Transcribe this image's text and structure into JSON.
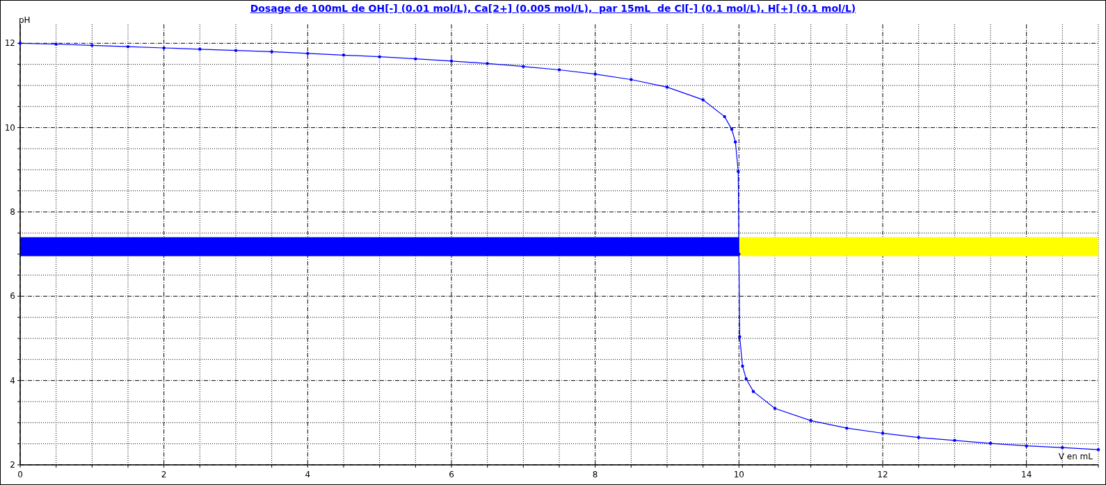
{
  "chart_data": {
    "type": "line",
    "title": "Dosage de 100mL de OH[-] (0.01 mol/L), Ca[2+] (0.005 mol/L),  par 15mL  de Cl[-] (0.1 mol/L), H[+] (0.1 mol/L)",
    "xlabel": "V en mL",
    "ylabel": "pH",
    "x": [
      0,
      0.5,
      1,
      1.5,
      2,
      2.5,
      3,
      3.5,
      4,
      4.5,
      5,
      5.5,
      6,
      6.5,
      7,
      7.5,
      8,
      8.5,
      9,
      9.5,
      9.8,
      9.9,
      9.95,
      9.99,
      10,
      10.01,
      10.05,
      10.1,
      10.2,
      10.5,
      11,
      11.5,
      12,
      12.5,
      13,
      13.5,
      14,
      14.5,
      15
    ],
    "series": [
      {
        "color": "#0000ff",
        "values": [
          12.0,
          11.98,
          11.95,
          11.92,
          11.89,
          11.86,
          11.83,
          11.8,
          11.76,
          11.72,
          11.68,
          11.63,
          11.58,
          11.52,
          11.45,
          11.37,
          11.27,
          11.14,
          10.96,
          10.66,
          10.26,
          9.96,
          9.66,
          8.96,
          7.0,
          5.04,
          4.34,
          4.04,
          3.74,
          3.34,
          3.05,
          2.87,
          2.75,
          2.65,
          2.58,
          2.51,
          2.45,
          2.41,
          2.36
        ]
      }
    ],
    "xlim": [
      0,
      15
    ],
    "ylim": [
      2,
      12.45
    ],
    "xticks": [
      0,
      2,
      4,
      6,
      8,
      10,
      12,
      14
    ],
    "yticks": [
      2,
      4,
      6,
      8,
      10,
      12
    ],
    "grid": true,
    "bands": [
      {
        "axis": "y",
        "from": 6.95,
        "to": 7.4,
        "color": "#0000ff"
      },
      {
        "axis": "y",
        "from": 6.95,
        "to": 7.4,
        "color": "#ffff00"
      }
    ]
  }
}
